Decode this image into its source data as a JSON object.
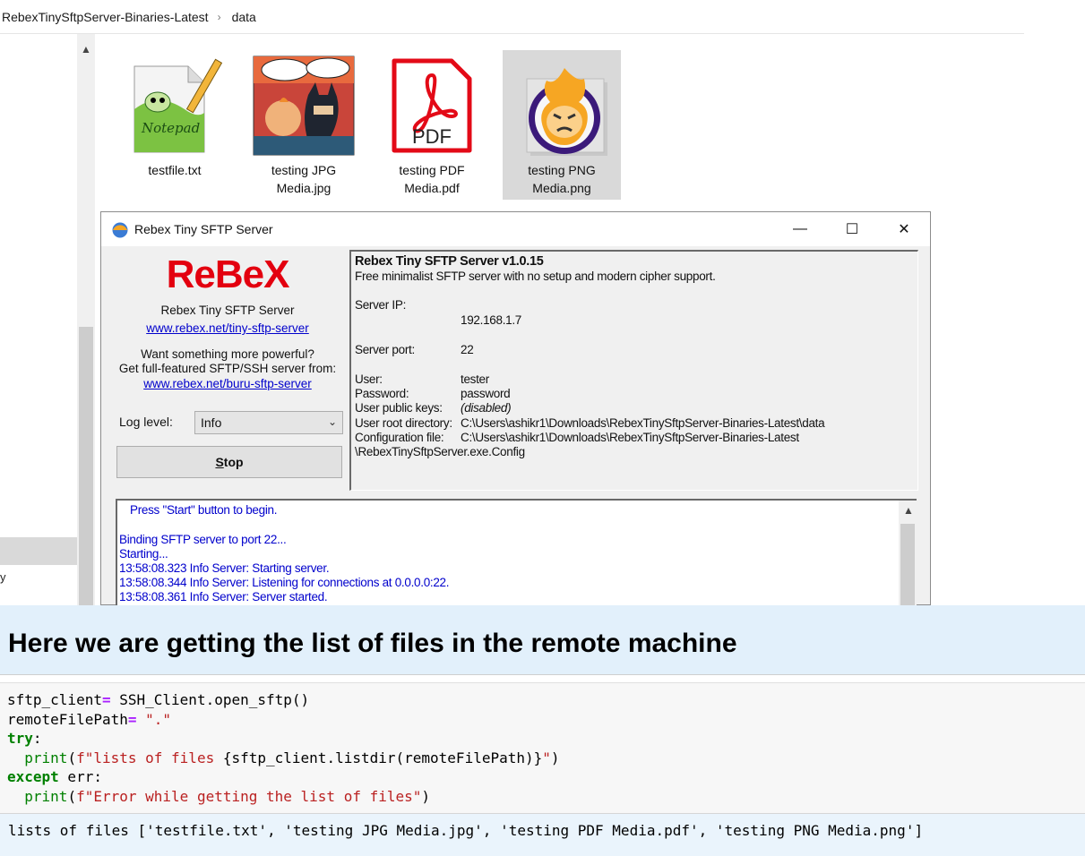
{
  "explorer": {
    "breadcrumb": [
      "RebexTinySftpServer-Binaries-Latest",
      "data"
    ],
    "breadcrumb_separator": "›",
    "nav_fragment": "y",
    "files": [
      {
        "name_line1": "testfile.txt",
        "name_line2": "",
        "icon": "notepad-plus-plus-icon"
      },
      {
        "name_line1": "testing JPG",
        "name_line2": "Media.jpg",
        "icon": "comic-image-thumbnail"
      },
      {
        "name_line1": "testing PDF",
        "name_line2": "Media.pdf",
        "icon": "pdf-icon"
      },
      {
        "name_line1": "testing PNG",
        "name_line2": "Media.png",
        "icon": "png-image-thumbnail",
        "selected": true
      }
    ]
  },
  "rebex_window": {
    "title": "Rebex Tiny SFTP Server",
    "controls": {
      "minimize": "—",
      "maximize": "☐",
      "close": "✕"
    },
    "logo_text": "ReBeX",
    "product_name": "Rebex Tiny SFTP Server",
    "product_link": "www.rebex.net/tiny-sftp-server",
    "promo_line1": "Want something more powerful?",
    "promo_line2": "Get full-featured SFTP/SSH server from:",
    "promo_link": "www.rebex.net/buru-sftp-server",
    "log_level_label": "Log level:",
    "log_level_value": "Info",
    "stop_label_first": "S",
    "stop_label_rest": "top",
    "info": {
      "heading": "Rebex Tiny SFTP Server v1.0.15",
      "subheading": "Free minimalist SFTP server with no setup and modern cipher support.",
      "server_ip_label": "Server IP:",
      "server_ip": "192.168.1.7",
      "server_port_label": "Server port:",
      "server_port": "22",
      "user_label": "User:",
      "user": "tester",
      "password_label": "Password:",
      "password": "password",
      "public_keys_label": "User public keys:",
      "public_keys": "(disabled)",
      "root_dir_label": "User root directory:",
      "root_dir": "C:\\Users\\ashikr1\\Downloads\\RebexTinySftpServer-Binaries-Latest\\data",
      "config_label": "Configuration file:",
      "config_line1": "C:\\Users\\ashikr1\\Downloads\\RebexTinySftpServer-Binaries-Latest",
      "config_line2": "\\RebexTinySftpServer.exe.Config"
    },
    "log_lines": [
      "Press \"Start\" button to begin.",
      "Binding SFTP server to port 22...",
      "Starting...",
      "13:58:08.323 Info Server: Starting server.",
      "13:58:08.344 Info Server: Listening for connections at 0.0.0.0:22.",
      "13:58:08.361 Info Server: Server started."
    ]
  },
  "notebook": {
    "heading": "Here we are getting the list of files in the remote machine",
    "output": "lists of files ['testfile.txt', 'testing JPG Media.jpg', 'testing PDF Media.pdf', 'testing PNG Media.png']"
  },
  "colors": {
    "link": "#0000cc",
    "log_text": "#0000cc",
    "rebex_red": "#e3000f",
    "heading_bg": "#e2f0fb",
    "keyword": "#008000",
    "string": "#ba2121",
    "operator": "#aa22ff"
  }
}
